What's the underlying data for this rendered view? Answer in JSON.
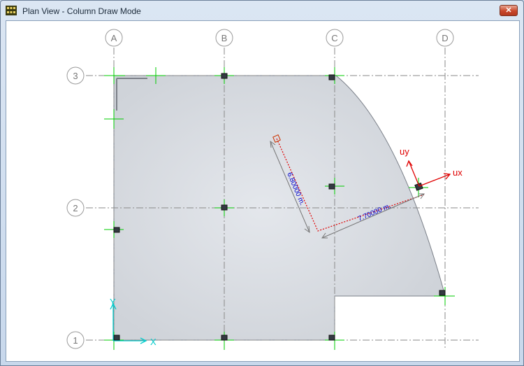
{
  "window": {
    "title": "Plan View - Column Draw Mode",
    "close_icon": "close-icon",
    "app_icon": "grid-app-icon"
  },
  "grid": {
    "columns": [
      "A",
      "B",
      "C",
      "D"
    ],
    "rows": [
      "3",
      "2",
      "1"
    ]
  },
  "dimensions": {
    "vertical": "6.80000 m.",
    "horizontal": "7.70000 m."
  },
  "axes": {
    "local_x": "ux",
    "local_y": "uy",
    "global_x": "X",
    "global_y": "Y"
  },
  "colors": {
    "slab_fill": "#d4d7dc",
    "grid_line": "#8a8a8a",
    "column_marker": "#00cc00",
    "dimension_line": "#e00000",
    "dimension_text": "#0000cc",
    "local_axis": "#e00000",
    "global_axis": "#00cccc"
  }
}
